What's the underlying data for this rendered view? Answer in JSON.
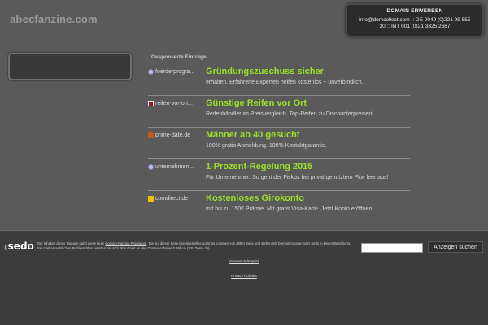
{
  "site": {
    "title": "abecfanzine.com"
  },
  "domain_box": {
    "title": "DOMAIN ERWERBEN",
    "line1": "info@domcollect.com :: DE 0049 (0)221 99 555",
    "line2": "30 :: INT 001 (0)21 3325 2687"
  },
  "sponsored_label": "Gesponserte Einträge",
  "ads": [
    {
      "source": "foerderprogra...",
      "icon": "globe-icon",
      "headline": "Gründungszuschuss sicher",
      "desc": "erhalten. Erfahrene Experten helfen kostenlos + unverbindlich."
    },
    {
      "source": "reifen-vor-ort...",
      "icon": "tire-icon",
      "headline": "Günstige Reifen vor Ort",
      "desc": "Reifenhändler im Preisvergleich. Top-Reifen zu Discounterpreisen!"
    },
    {
      "source": "prime-date.de",
      "icon": "prime-date-icon",
      "headline": "Männer ab 40 gesucht",
      "desc": "100% gratis Anmeldung. 100% Kontaktgarantie."
    },
    {
      "source": "unternehmen...",
      "icon": "globe-icon",
      "headline": "1-Prozent-Regelung 2015",
      "desc": "Für Unternehmer: So geht der Fiskus bei privat genutztem Pkw leer aus!"
    },
    {
      "source": "comdirect.de",
      "icon": "comdirect-icon",
      "headline": "Kostenloses Girokonto",
      "desc": "mit bis zu 150€ Prämie. Mit gratis Visa-Karte. Jetzt Konto eröffnen!"
    }
  ],
  "footer": {
    "logo": "sedo",
    "disclaimer_pre": "Der Inhaber dieser Domain parkt diese beim ",
    "disclaimer_link": "Domain-Parking-Programm",
    "disclaimer_post": ". Die auf dieser Seite bereitgestellten Listings kommen von dritter Seite und stehen mit Domain-Inhaber oder Sedo in keiner Beziehung. Bei markenrechtlichen Problemfällen wenden Sie sich bitte direkt an den Domain-Inhaber lt. Whois (z.B. Denic.de).",
    "search_button": "Anzeigen suchen",
    "search_placeholder": "",
    "impressum": "Impressum/Imprint",
    "privacy": "Privacy Policies"
  }
}
